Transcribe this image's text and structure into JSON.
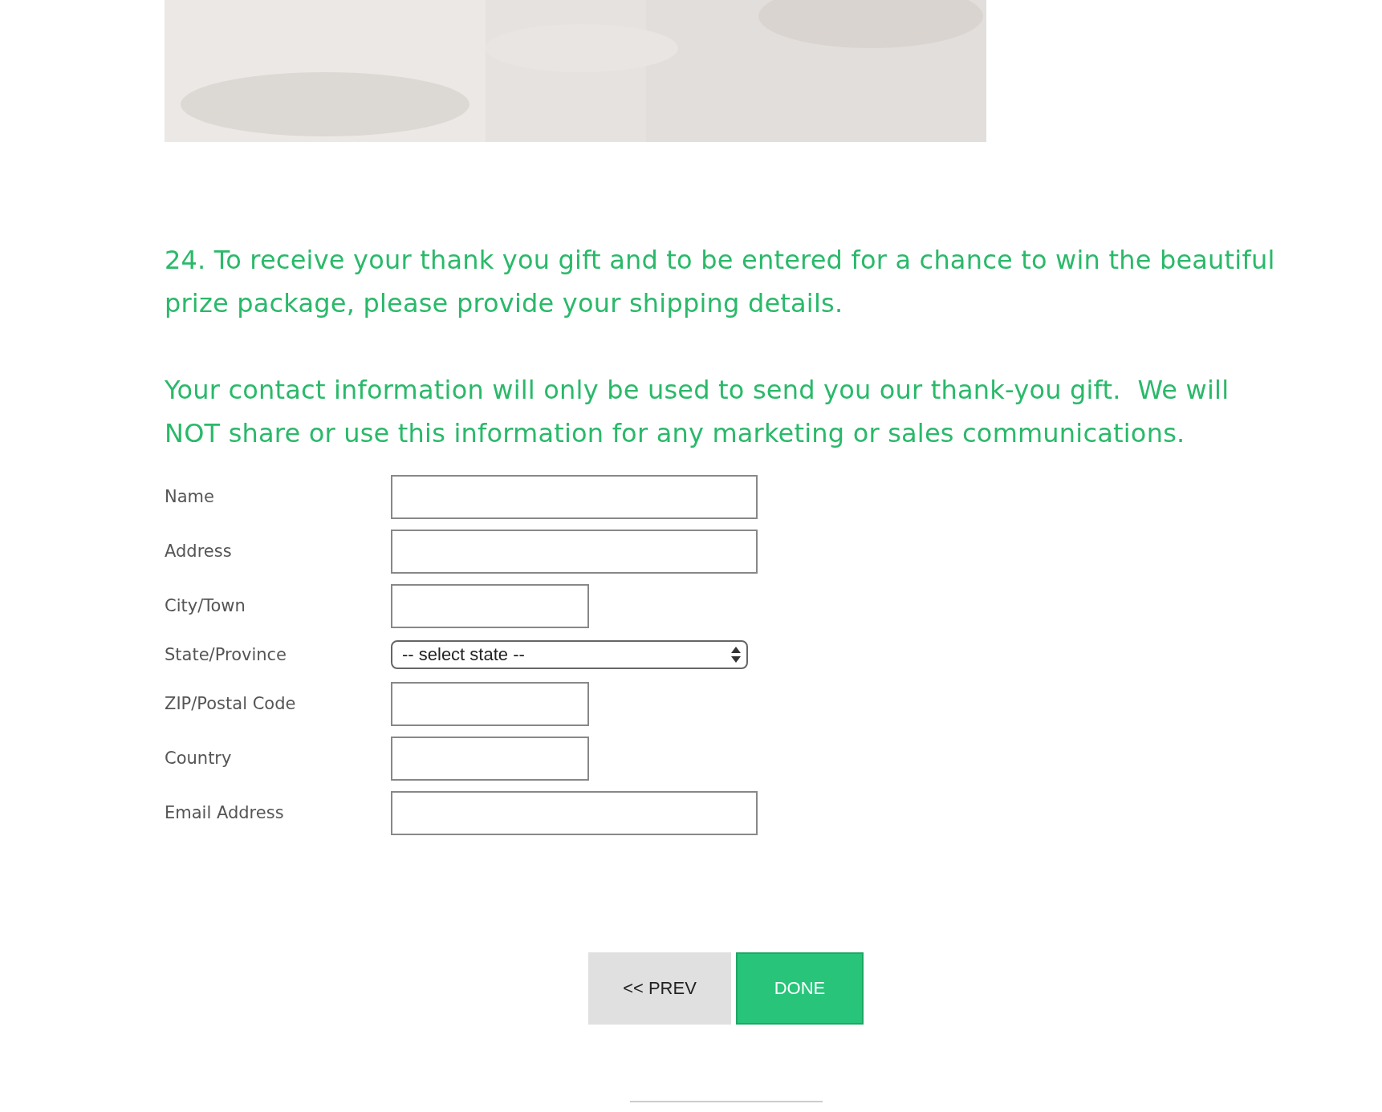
{
  "question": "24. To receive your thank you gift and to be entered for a chance to win the beautiful prize package, please provide your shipping details.",
  "notice": "Your contact information will only be used to send you our thank-you gift.  We will NOT share or use this information for any marketing or sales communications.",
  "fields": [
    {
      "label": "Name",
      "kind": "text"
    },
    {
      "label": "Address",
      "kind": "text"
    },
    {
      "label": "City/Town",
      "kind": "short"
    },
    {
      "label": "State/Province",
      "kind": "select",
      "value": "-- select state --"
    },
    {
      "label": "ZIP/Postal Code",
      "kind": "short"
    },
    {
      "label": "Country",
      "kind": "short"
    },
    {
      "label": "Email Address",
      "kind": "text"
    }
  ],
  "buttons": [
    {
      "label": "<< PREV",
      "kind": "secondary"
    },
    {
      "label": "DONE",
      "kind": "primary"
    }
  ]
}
